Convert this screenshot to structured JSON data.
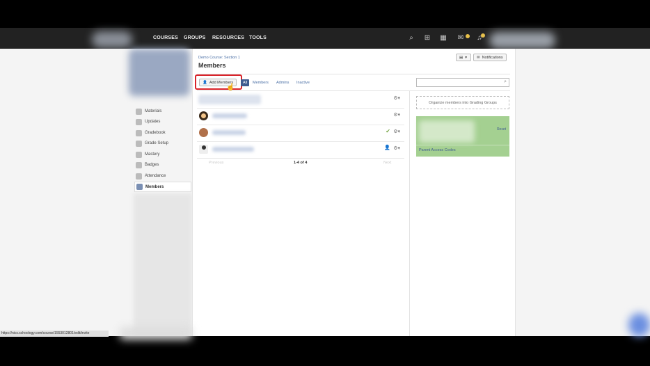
{
  "nav": {
    "courses": "COURSES",
    "groups": "GROUPS",
    "resources": "RESOURCES",
    "tools": "TOOLS",
    "icons": [
      "search-icon",
      "apps-grid-icon",
      "calendar-icon",
      "mail-icon",
      "bell-icon"
    ]
  },
  "sidebar": {
    "items": [
      {
        "label": "Materials",
        "icon": "folder-icon"
      },
      {
        "label": "Updates",
        "icon": "updates-icon"
      },
      {
        "label": "Gradebook",
        "icon": "gradebook-icon"
      },
      {
        "label": "Grade Setup",
        "icon": "grade-setup-icon"
      },
      {
        "label": "Mastery",
        "icon": "mastery-icon"
      },
      {
        "label": "Badges",
        "icon": "badge-icon"
      },
      {
        "label": "Attendance",
        "icon": "attendance-icon"
      },
      {
        "label": "Members",
        "icon": "members-icon",
        "active": true
      }
    ]
  },
  "header": {
    "breadcrumb": "Demo Course: Section 1",
    "title": "Members",
    "notifications_label": "Notifications"
  },
  "toolbar": {
    "add_members_label": "Add Members",
    "tabs": [
      {
        "label": "All",
        "active": true
      },
      {
        "label": "Members"
      },
      {
        "label": "Admins"
      },
      {
        "label": "Inactive"
      }
    ]
  },
  "members": {
    "rows": [
      {
        "avatar": "none",
        "status": ""
      },
      {
        "avatar": "person-dark-hair-avatar",
        "status": ""
      },
      {
        "avatar": "person-photo-avatar",
        "status": "check"
      },
      {
        "avatar": "person-admin-avatar",
        "status": "admin"
      }
    ],
    "pager": {
      "previous": "Previous",
      "count": "1-4 of 4",
      "next": "Next"
    }
  },
  "right_panel": {
    "organize_label": "Organize members into Grading Groups",
    "reset_label": "Reset",
    "parent_codes_label": "Parent Access Codes"
  },
  "status_bar": {
    "url": "https://nics.schoology.com/course/1553012801/edit/invite"
  },
  "colors": {
    "accent": "#3e5b8f",
    "highlight_box": "#d9232a",
    "green_panel": "#a4d091"
  }
}
